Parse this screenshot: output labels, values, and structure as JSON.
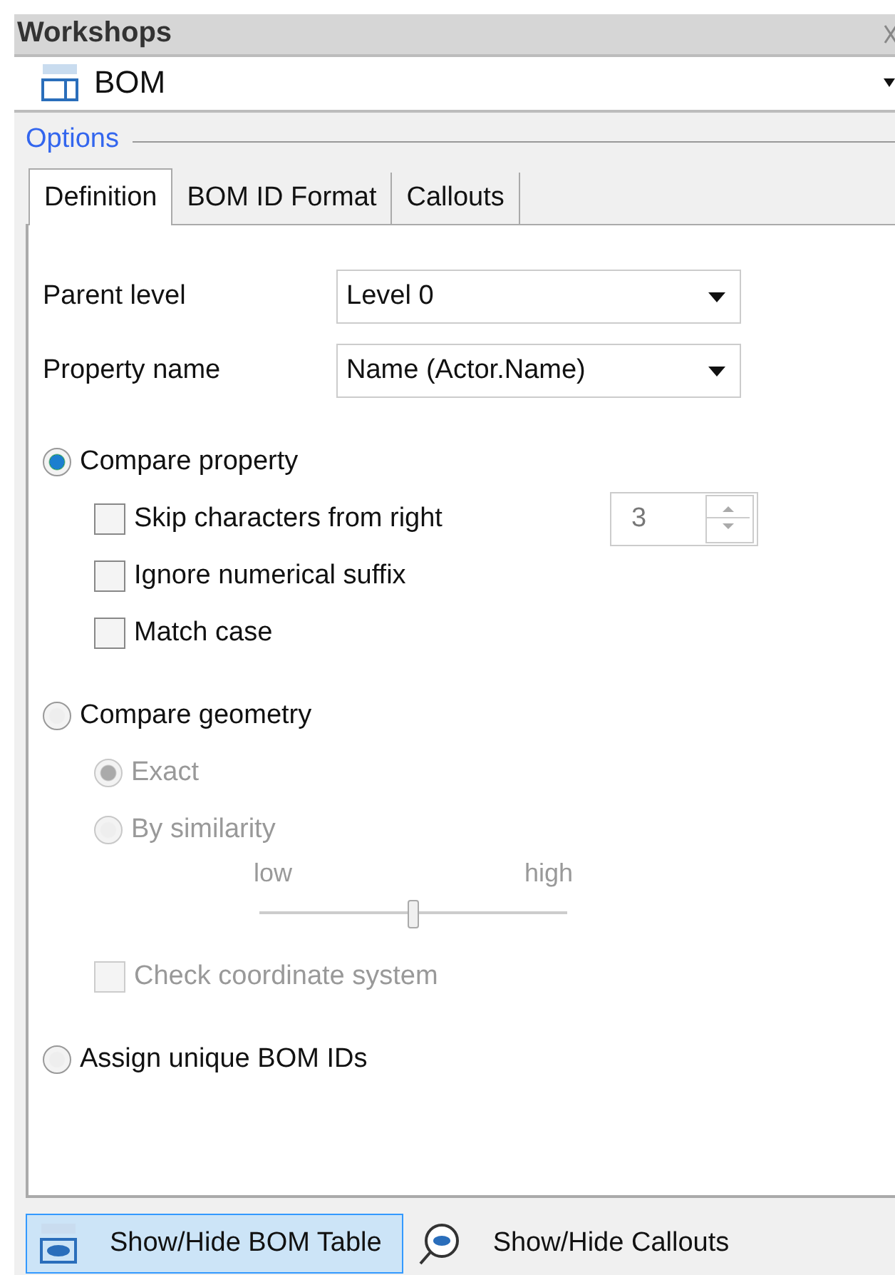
{
  "panel": {
    "title": "Workshops"
  },
  "workshop_selector": {
    "value": "BOM"
  },
  "options": {
    "label": "Options"
  },
  "tabs": [
    {
      "label": "Definition",
      "selected": true
    },
    {
      "label": "BOM ID Format",
      "selected": false
    },
    {
      "label": "Callouts",
      "selected": false
    }
  ],
  "fields": [
    {
      "label": "Parent level",
      "value": "Level 0"
    },
    {
      "label": "Property name",
      "value": "Name (Actor.Name)"
    }
  ],
  "modes": [
    {
      "label": "Compare property",
      "selected": true,
      "options": [
        {
          "kind": "checkbox",
          "label": "Skip characters from right",
          "checked": false,
          "disabled": false,
          "spinner": "3"
        },
        {
          "kind": "checkbox",
          "label": "Ignore numerical suffix",
          "checked": false,
          "disabled": false
        },
        {
          "kind": "checkbox",
          "label": "Match case",
          "checked": false,
          "disabled": false
        }
      ]
    },
    {
      "label": "Compare geometry",
      "selected": false,
      "options": [
        {
          "kind": "radio",
          "label": "Exact",
          "selected": true,
          "disabled": true
        },
        {
          "kind": "radio",
          "label": "By similarity",
          "selected": false,
          "disabled": true
        },
        {
          "kind": "slider",
          "low": "low",
          "high": "high",
          "level": 0.5,
          "disabled": true
        },
        {
          "kind": "checkbox",
          "label": "Check coordinate system",
          "checked": false,
          "disabled": true
        }
      ]
    },
    {
      "label": "Assign unique BOM IDs",
      "selected": false
    }
  ],
  "toolbar": [
    {
      "kind": "table",
      "label": "Show/Hide BOM Table",
      "selected": true
    },
    {
      "kind": "callouts",
      "label": "Show/Hide Callouts",
      "selected": false
    }
  ]
}
